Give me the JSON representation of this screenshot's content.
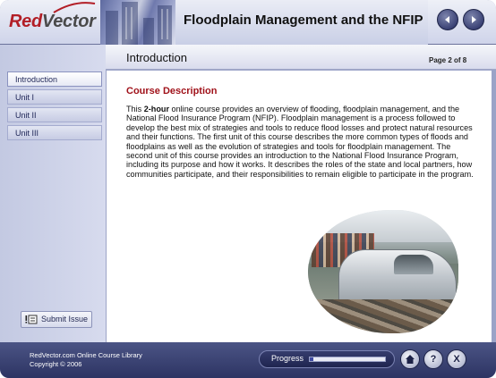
{
  "header": {
    "logo_part1": "Red",
    "logo_part2": "Vector",
    "course_title": "Floodplain Management and the NFIP",
    "prev_icon": "left-arrow-icon",
    "next_icon": "right-arrow-icon"
  },
  "sidebar": {
    "items": [
      {
        "label": "Introduction",
        "active": true
      },
      {
        "label": "Unit I",
        "active": false
      },
      {
        "label": "Unit II",
        "active": false
      },
      {
        "label": "Unit III",
        "active": false
      }
    ],
    "submit_label": "Submit Issue"
  },
  "main": {
    "section_title": "Introduction",
    "page_indicator": "Page 2 of 8",
    "heading": "Course Description",
    "body_pre": "This ",
    "body_bold": "2-hour",
    "body_post": " online course provides an overview of flooding, floodplain management, and the National Flood Insurance Program (NFIP). Floodplain management is a process followed to develop the best mix of strategies and tools to reduce flood losses and protect natural resources and their functions. The first unit of this course describes the more common types of floods and floodplains as well as the evolution of strategies and tools for floodplain management. The second unit of this course provides an introduction to the National Flood Insurance Program, including its purpose and how it works. It describes the roles of the state and local partners, how communities participate, and their responsibilities to remain eligible to participate in the program."
  },
  "footer": {
    "line1": "RedVector.com Online Course Library",
    "line2": "Copyright © 2006",
    "progress_label": "Progress",
    "progress_fraction": 0.05
  },
  "colors": {
    "accent_red": "#a0121a",
    "frame_blue": "#2d3463"
  }
}
